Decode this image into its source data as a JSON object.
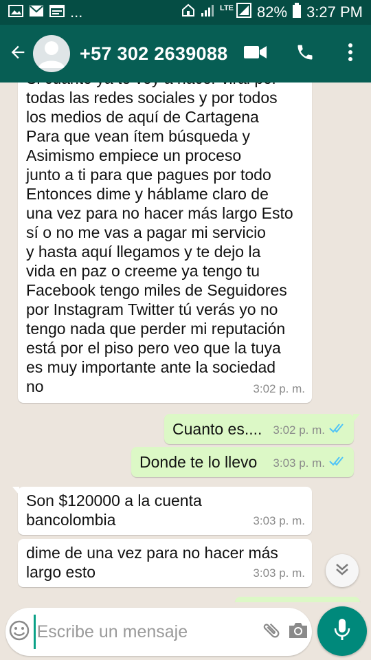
{
  "status_bar": {
    "battery": "82%",
    "time": "3:27 PM",
    "overflow": "...",
    "network": "LTE",
    "icons": [
      "image-icon",
      "mail-icon",
      "calendar-icon",
      "home-icon",
      "signal-icon",
      "lte-signal-icon",
      "battery-icon"
    ]
  },
  "header": {
    "title": "+57 302 2639088",
    "icons": [
      "back-arrow-icon",
      "avatar-placeholder-icon",
      "video-call-icon",
      "voice-call-icon",
      "more-vert-icon"
    ]
  },
  "messages": [
    {
      "direction": "incoming",
      "text": "Si cuanto ya te voy a hacer viral por\ntodas las redes sociales y por todos\nlos medios de aquí de Cartagena\nPara que vean ítem búsqueda y\nAsimismo empiece un proceso\njunto a ti para que pagues por todo\nEntonces dime y háblame claro de\nuna vez para no hacer más largo Esto\nsí o no me vas a pagar mi servicio\ny hasta aquí llegamos y te dejo la\nvida en paz o creeme ya tengo tu\nFacebook tengo miles de Seguidores\npor Instagram Twitter tú verás yo no\ntengo nada que perder mi reputación\nestá por el piso pero veo que la tuya\nes muy importante ante la sociedad\nno",
      "time": "3:02 p. m."
    },
    {
      "direction": "outgoing",
      "text": "Cuanto es....",
      "time": "3:02 p. m.",
      "status": "read"
    },
    {
      "direction": "outgoing",
      "text": "Donde te lo llevo",
      "time": "3:03 p. m.",
      "status": "read"
    },
    {
      "direction": "incoming",
      "text": "Son $120000 a la cuenta\nbancolombia",
      "time": "3:03 p. m."
    },
    {
      "direction": "incoming",
      "text": "dime de una vez para no hacer más\nlargo esto",
      "time": "3:03 p. m."
    }
  ],
  "composer": {
    "placeholder": "Escribe un mensaje",
    "icons": [
      "emoji-icon",
      "attach-icon",
      "camera-icon",
      "mic-icon",
      "scroll-down-icon"
    ]
  },
  "colors": {
    "status_bar": "#054d44",
    "app_bar": "#075e54",
    "chat_bg": "#ece5dd",
    "incoming_bubble": "#ffffff",
    "outgoing_bubble": "#dcf8c6",
    "read_ticks": "#4fc3f7",
    "mic_button": "#00897b"
  }
}
